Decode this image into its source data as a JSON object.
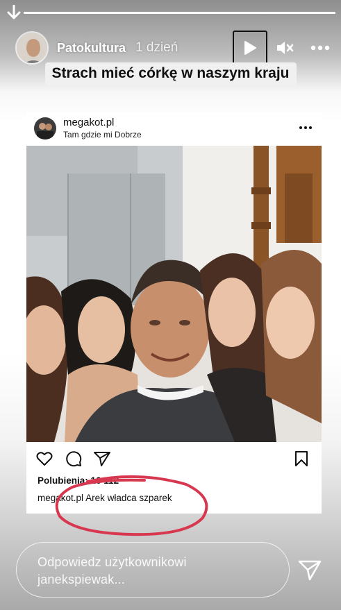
{
  "story": {
    "progress": 1.0,
    "username": "Patokultura",
    "time": "1 dzień",
    "caption": "Strach mieć córkę w naszym kraju"
  },
  "post": {
    "username": "megakot.pl",
    "location": "Tam gdzie mi Dobrze",
    "likes_label": "Polubienia:",
    "likes_count": "16 112",
    "caption_user": "megakot.pl",
    "caption_text": "Arek władca szparek"
  },
  "reply": {
    "placeholder": "Odpowiedz użytkownikowi janekspiewak..."
  },
  "colors": {
    "annotation": "#d8384f",
    "story_text": "#ffffff",
    "caption_bg": "#f0f0f0"
  },
  "icons": [
    "swipe-down-arrow-icon",
    "play-icon",
    "muted-speaker-icon",
    "more-dots-icon",
    "heart-icon",
    "comment-icon",
    "share-icon",
    "bookmark-icon",
    "send-icon"
  ]
}
